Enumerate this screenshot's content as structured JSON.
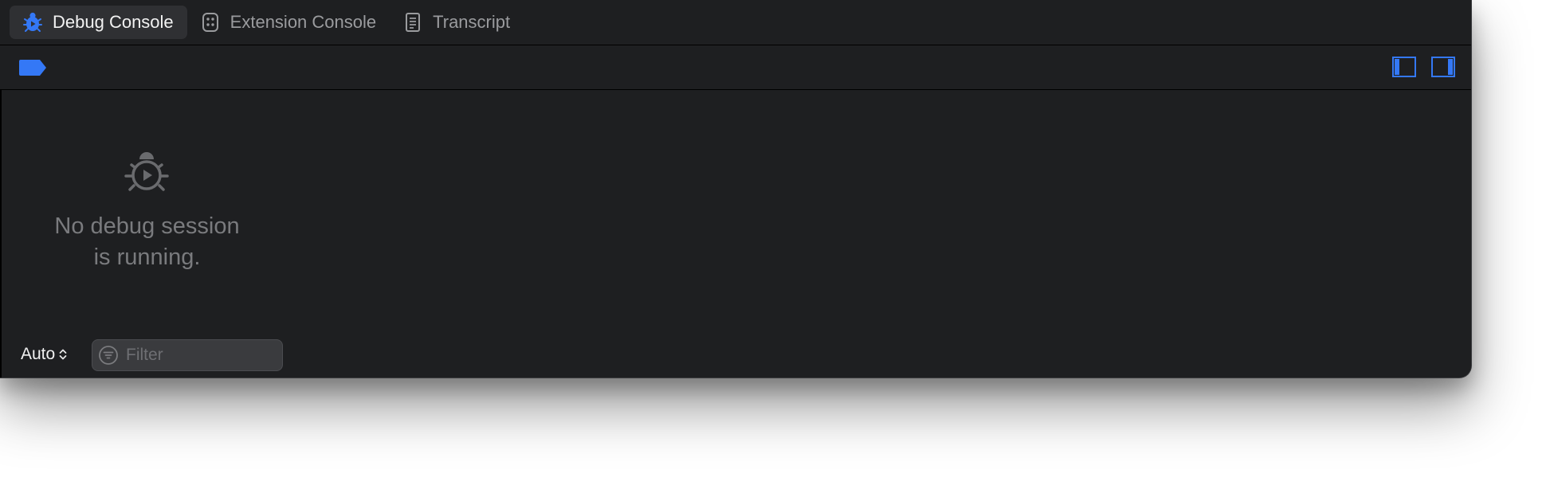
{
  "tabs": [
    {
      "label": "Debug Console",
      "icon": "bug-play-icon",
      "active": true
    },
    {
      "label": "Extension Console",
      "icon": "extension-icon",
      "active": false
    },
    {
      "label": "Transcript",
      "icon": "document-icon",
      "active": false
    }
  ],
  "toolbar": {
    "tag_icon": "tag-icon",
    "left_panel_toggle_icon": "sidebar-left-icon",
    "right_panel_toggle_icon": "sidebar-right-icon"
  },
  "sidebar": {
    "empty_icon": "bug-play-icon",
    "empty_message_line1": "No debug session",
    "empty_message_line2": "is running.",
    "scope_select": "Auto",
    "filter": {
      "placeholder": "Filter",
      "value": ""
    }
  },
  "colors": {
    "accent": "#3478f6",
    "background": "#1e1f21",
    "active_tab": "#2f3033",
    "muted_text": "#7a7b7e"
  }
}
